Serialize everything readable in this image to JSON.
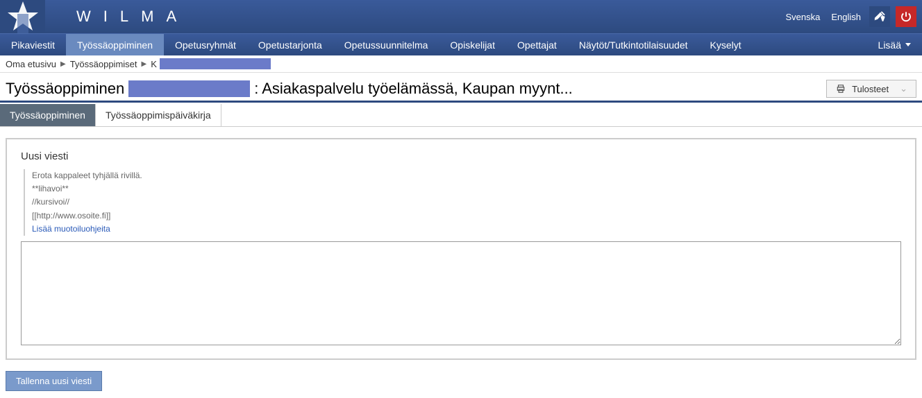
{
  "brand": "WILMA",
  "languages": {
    "sv": "Svenska",
    "en": "English"
  },
  "nav": {
    "items": [
      "Pikaviestit",
      "Työssäoppiminen",
      "Opetusryhmät",
      "Opetustarjonta",
      "Opetussuunnitelma",
      "Opiskelijat",
      "Opettajat",
      "Näytöt/Tutkintotilaisuudet",
      "Kyselyt"
    ],
    "more": "Lisää"
  },
  "breadcrumb": {
    "home": "Oma etusivu",
    "level2": "Työssäoppimiset",
    "level3_prefix": "K"
  },
  "page": {
    "title_prefix": "Työssäoppiminen",
    "title_suffix": ": Asiakaspalvelu työelämässä, Kaupan myynt...",
    "print_label": "Tulosteet"
  },
  "tabs": {
    "t1": "Työssäoppiminen",
    "t2": "Työssäoppimispäiväkirja"
  },
  "form": {
    "section_title": "Uusi viesti",
    "hint_line1": "Erota kappaleet tyhjällä rivillä.",
    "hint_line2": "**lihavoi**",
    "hint_line3": "//kursivoi//",
    "hint_line4": "[[http://www.osoite.fi]]",
    "hint_link": "Lisää muotoiluohjeita",
    "textarea_value": "",
    "save_label": "Tallenna uusi viesti"
  }
}
